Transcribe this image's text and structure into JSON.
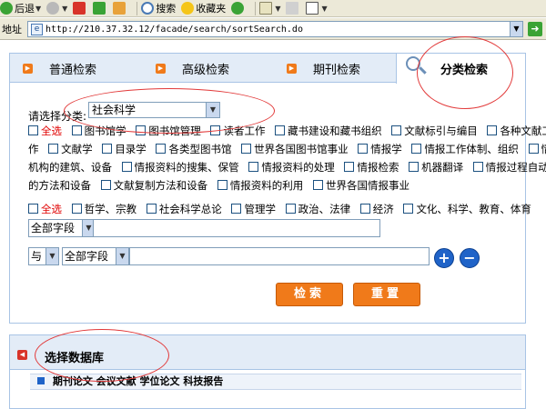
{
  "browser": {
    "back_label": "后退",
    "search_label": "搜索",
    "favorites_label": "收藏夹",
    "address_label": "地址",
    "url": "http://210.37.32.12/facade/search/sortSearch.do"
  },
  "tabs": [
    {
      "label": "普通检索"
    },
    {
      "label": "高级检索"
    },
    {
      "label": "期刊检索"
    },
    {
      "label": "分类检索",
      "active": true
    }
  ],
  "category": {
    "label": "请选择分类:",
    "selected": "社会科学"
  },
  "options_group1": {
    "select_all": "全选",
    "line1": [
      "图书馆学",
      "图书馆管理",
      "读者工作",
      "藏书建设和藏书组织",
      "文献标引与编目",
      "各种文献工"
    ],
    "line2_lead": "作",
    "line2": [
      "文献学",
      "目录学",
      "各类型图书馆",
      "世界各国图书馆事业",
      "情报学",
      "情报工作体制、组织",
      "情报"
    ],
    "line3_lead": "机构的建筑、设备",
    "line3": [
      "情报资料的搜集、保管",
      "情报资料的处理",
      "情报检索",
      "机器翻译",
      "情报过程自动化"
    ],
    "line4_lead": "的方法和设备",
    "line4": [
      "文献复制方法和设备",
      "情报资料的利用",
      "世界各国情报事业"
    ]
  },
  "options_group2": {
    "select_all": "全选",
    "items": [
      "哲学、宗教",
      "社会科学总论",
      "管理学",
      "政治、法律",
      "经济",
      "文化、科学、教育、体育"
    ]
  },
  "search_rows": {
    "row1_field": "全部字段",
    "row2_logic": "与",
    "row2_field": "全部字段"
  },
  "buttons": {
    "add": "+",
    "remove": "−",
    "search": "检索",
    "reset": "重置"
  },
  "database": {
    "title": "选择数据库",
    "types": "期刊论文 会议文献 学位论文 科技报告"
  },
  "colors": {
    "accent_orange": "#f07a1a",
    "tab_bg": "#e3ecf7",
    "annotation_red": "#e23a3a",
    "select_all_red": "#e00000"
  }
}
